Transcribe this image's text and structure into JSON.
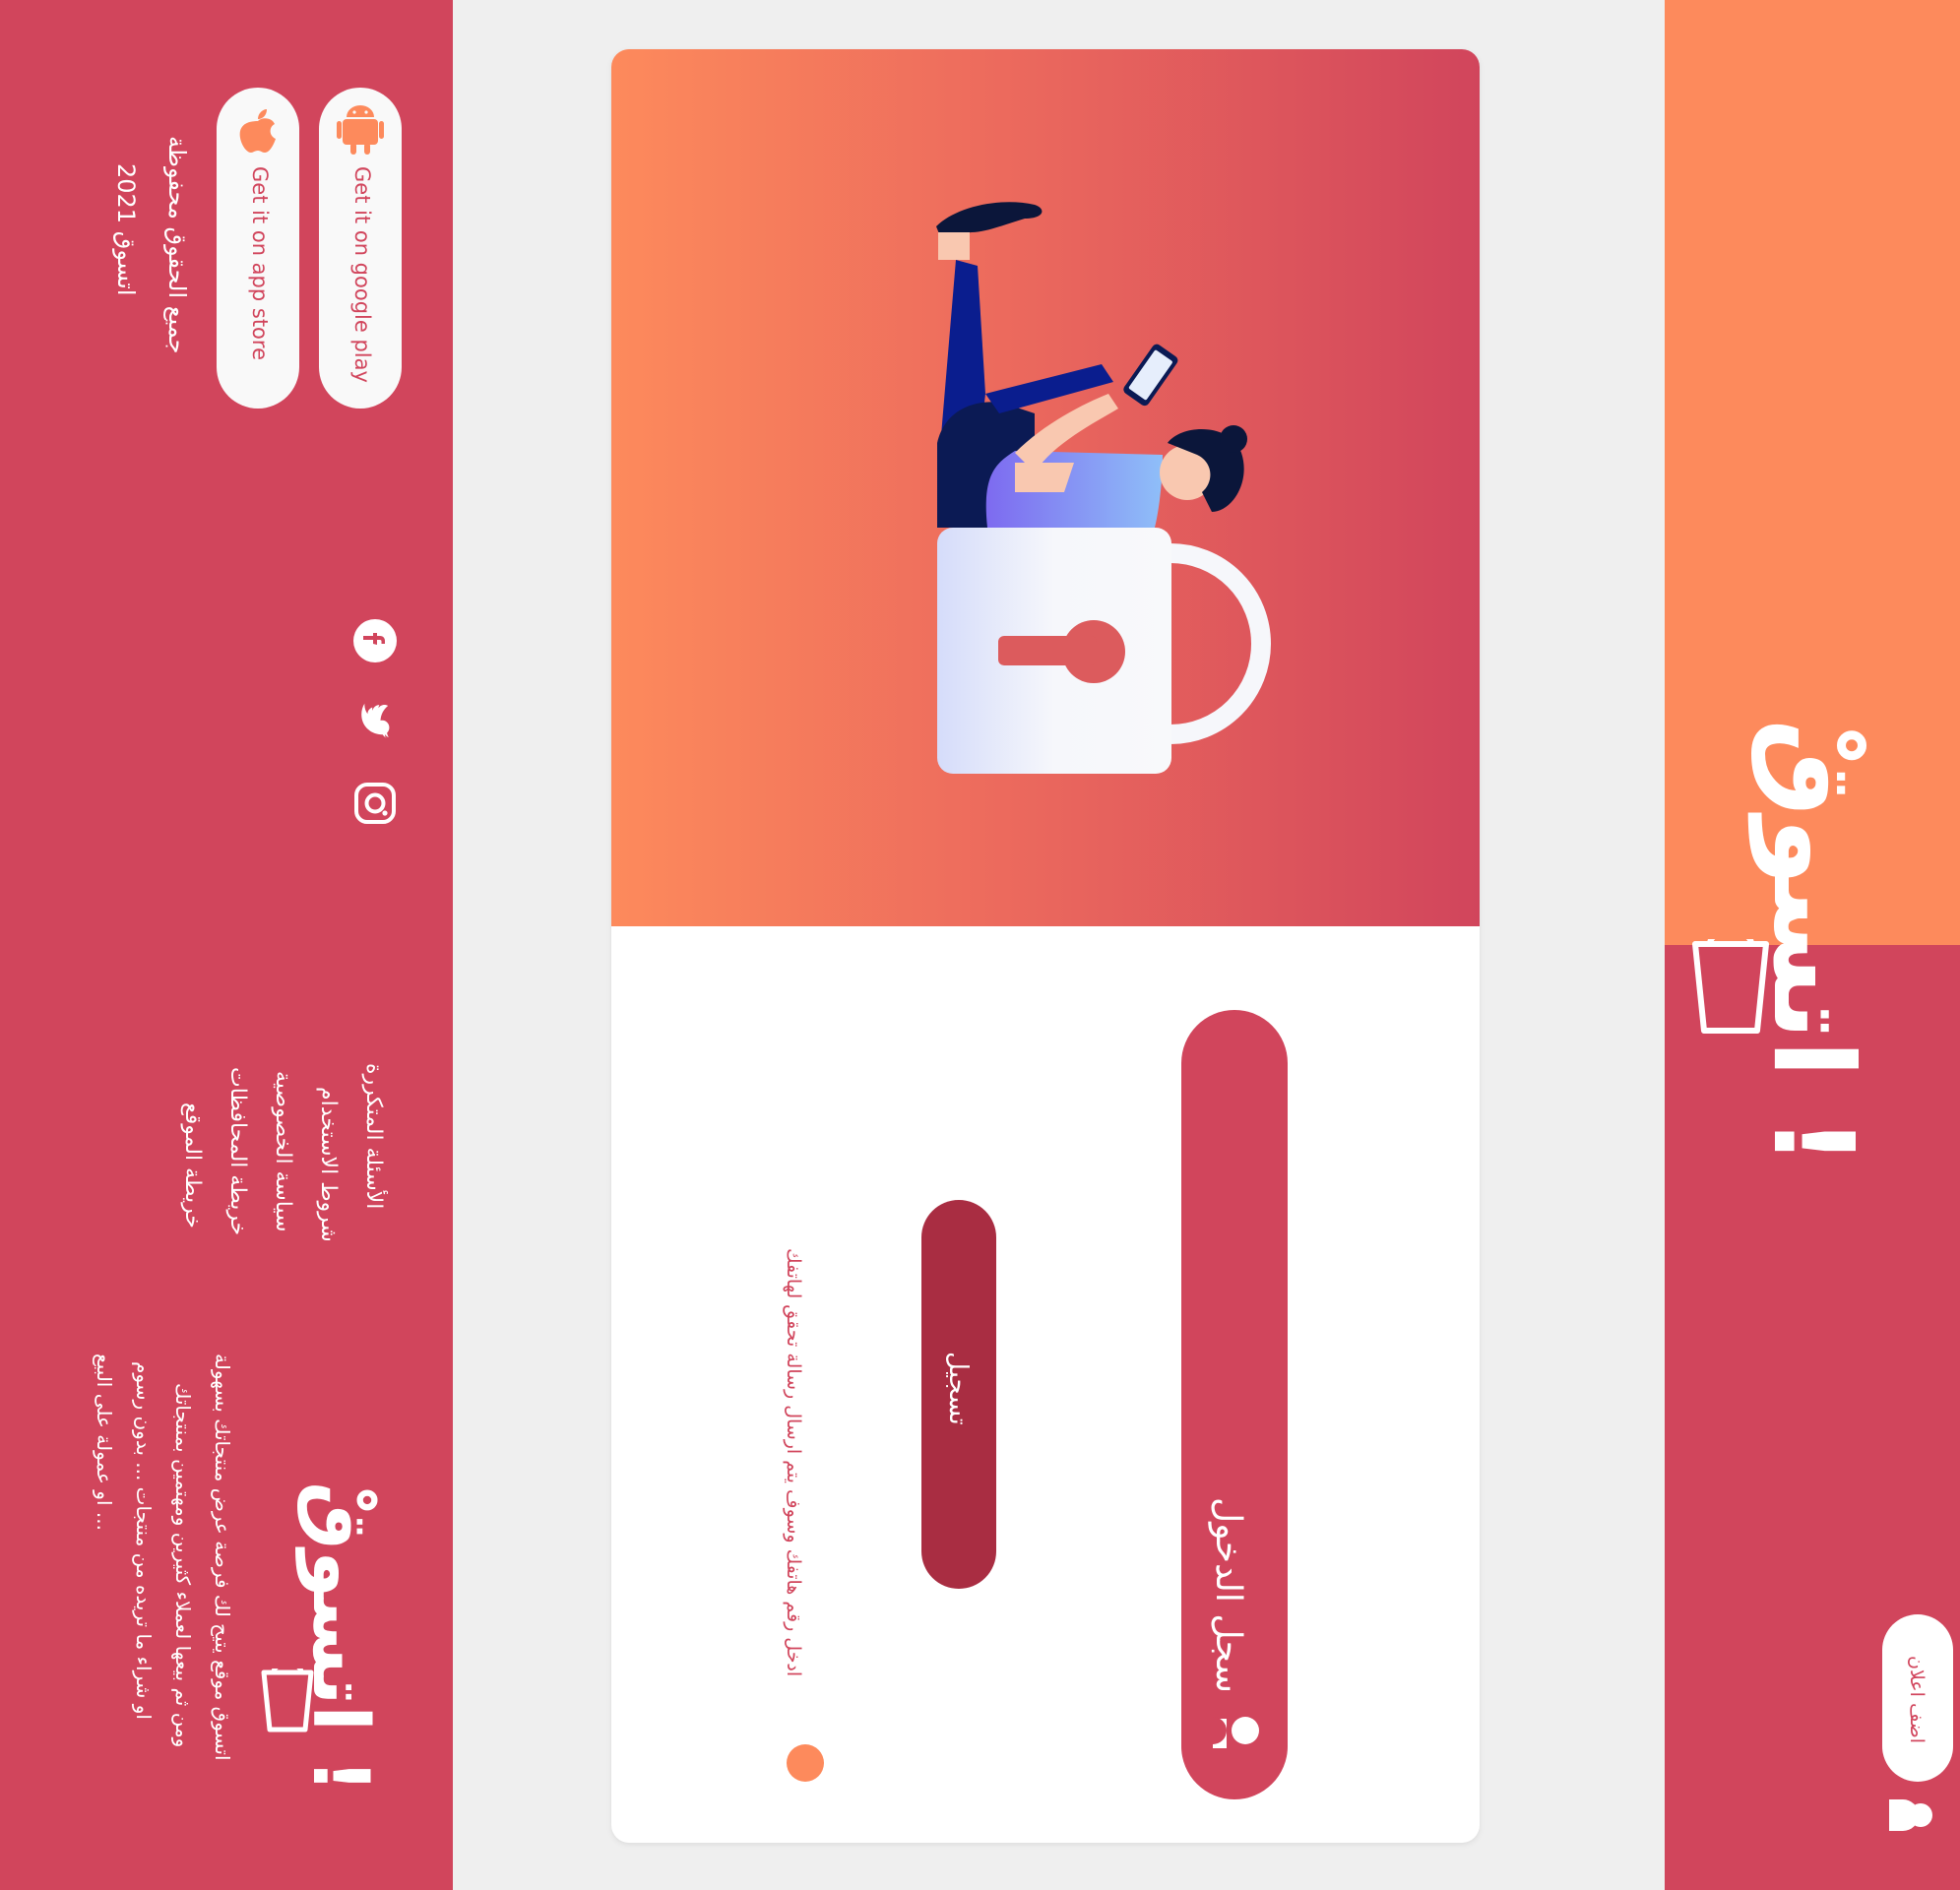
{
  "brand": {
    "name": "اتسوقْ !",
    "colors": {
      "primary": "#d1455c",
      "accent": "#fd8a5c",
      "dark": "#a92d42",
      "light": "#f9f9f9"
    }
  },
  "header": {
    "account_label": "اضف اعلان",
    "account_icon": "user-icon"
  },
  "login_card": {
    "register_button": "سجل الدخول",
    "register_icon": "user-icon",
    "submit_button": "تسجيل",
    "hint_text": "ادخل رقم هاتفك وسوف يتم ارسال رسالة تحقق لهاتفك",
    "illustration": "person-on-padlock-illustration"
  },
  "footer": {
    "about_text": [
      "اتسوق موقع يتيح لك فرصة عرض منتجاتك بسهولة",
      "ومن ثم بيعها لعملاء كثيرين ومهتمين بمنتجاتك",
      "او شراء ما تريده من منتجات ... بدون رسوم",
      "او عمولة على البيع ..."
    ],
    "links": [
      "الأسئلة المتكررة",
      "شروط الاستخدام",
      "سياسة الخصوصية",
      "خريطة المحافظات",
      "خريطة الموقع"
    ],
    "store_buttons": [
      {
        "label": "Get it on google play",
        "icon": "android-icon"
      },
      {
        "label": "Get it on app store",
        "icon": "apple-icon"
      }
    ],
    "social_icons": [
      "facebook-icon",
      "twitter-icon",
      "instagram-icon"
    ],
    "copyright": [
      "جميع الحقوق محفوظة",
      "اتسوق 2021"
    ]
  }
}
